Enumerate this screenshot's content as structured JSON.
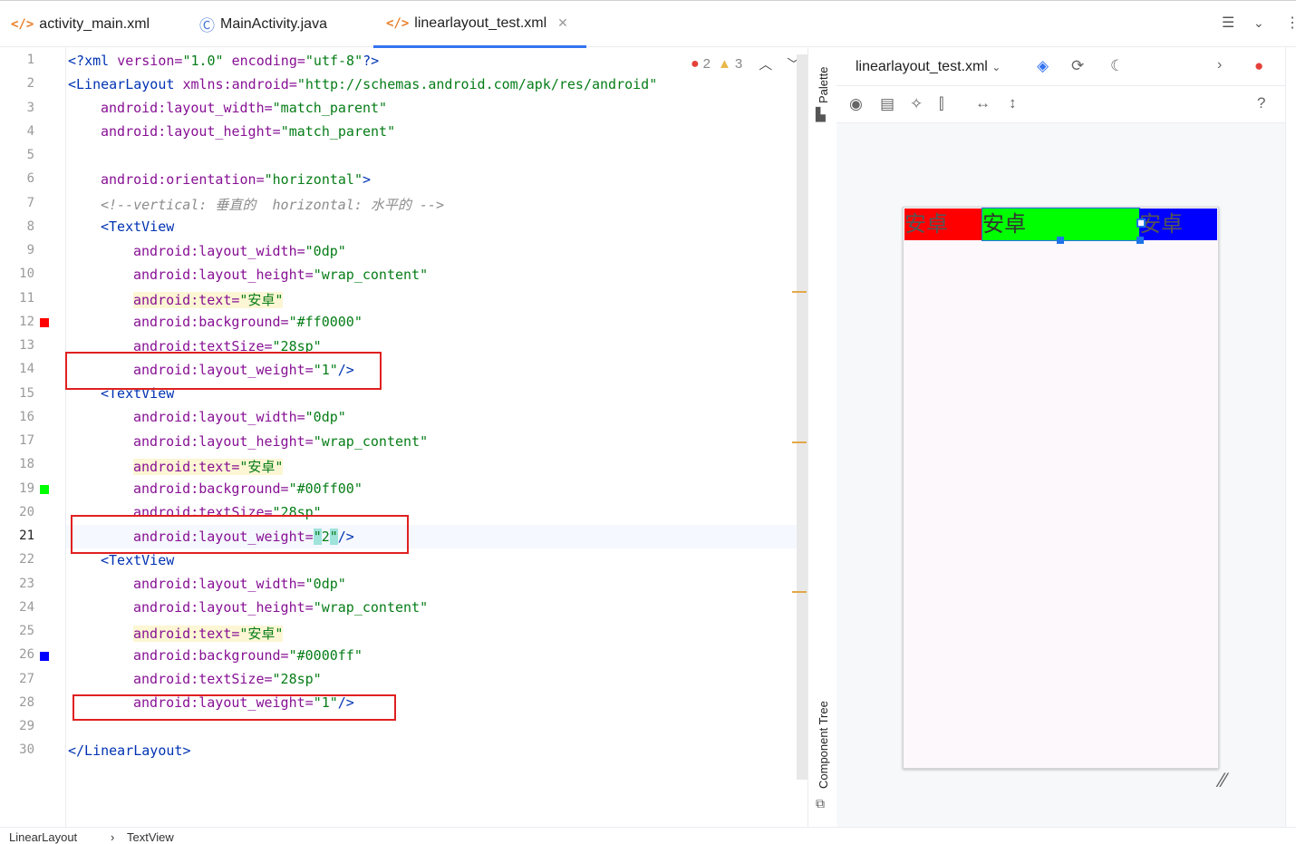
{
  "tabs": [
    {
      "label": "activity_main.xml",
      "icon": "xml-icon",
      "active": false
    },
    {
      "label": "MainActivity.java",
      "icon": "class-icon",
      "active": false
    },
    {
      "label": "linearlayout_test.xml",
      "icon": "xml-icon",
      "active": true
    }
  ],
  "problems": {
    "errors": "2",
    "warnings": "3"
  },
  "line_numbers": [
    "1",
    "2",
    "3",
    "4",
    "5",
    "6",
    "7",
    "8",
    "9",
    "10",
    "11",
    "12",
    "13",
    "14",
    "15",
    "16",
    "17",
    "18",
    "19",
    "20",
    "21",
    "22",
    "23",
    "24",
    "25",
    "26",
    "27",
    "28",
    "29",
    "30"
  ],
  "current_line": "21",
  "code": {
    "l1": {
      "a": "<?",
      "b": "xml ",
      "c": "version=",
      "d": "\"1.0\"",
      "e": " encoding=",
      "f": "\"utf-8\"",
      "g": "?>"
    },
    "l2": {
      "tag": "<LinearLayout ",
      "attr": "xmlns:android=",
      "val": "\"http://schemas.android.com/apk/res/android\""
    },
    "l3": {
      "attr": "android:layout_width=",
      "val": "\"match_parent\""
    },
    "l4": {
      "attr": "android:layout_height=",
      "val": "\"match_parent\""
    },
    "l6": {
      "attr": "android:orientation=",
      "val": "\"horizontal\"",
      "end": ">"
    },
    "l7": {
      "cm": "<!--vertical: 垂直的  horizontal: 水平的 -->"
    },
    "l8": {
      "tag": "<TextView"
    },
    "l9": {
      "attr": "android:layout_width=",
      "val": "\"0dp\""
    },
    "l10": {
      "attr": "android:layout_height=",
      "val": "\"wrap_content\""
    },
    "l11": {
      "attr": "android:text=",
      "val": "\"安卓\""
    },
    "l12": {
      "attr": "android:background=",
      "val": "\"#ff0000\""
    },
    "l13": {
      "attr": "android:textSize=",
      "val": "\"28sp\""
    },
    "l14": {
      "attr": "android:layout_weight=",
      "val": "\"1\"",
      "end": "/>"
    },
    "l15": {
      "tag": "<TextView"
    },
    "l16": {
      "attr": "android:layout_width=",
      "val": "\"0dp\""
    },
    "l17": {
      "attr": "android:layout_height=",
      "val": "\"wrap_content\""
    },
    "l18": {
      "attr": "android:text=",
      "val": "\"安卓\""
    },
    "l19": {
      "attr": "android:background=",
      "val": "\"#00ff00\""
    },
    "l20": {
      "attr": "android:textSize=",
      "val": "\"28sp\""
    },
    "l21": {
      "attr": "android:layout_weight=",
      "q1": "\"",
      "v": "2",
      "q2": "\"",
      "end": "/>"
    },
    "l22": {
      "tag": "<TextView"
    },
    "l23": {
      "attr": "android:layout_width=",
      "val": "\"0dp\""
    },
    "l24": {
      "attr": "android:layout_height=",
      "val": "\"wrap_content\""
    },
    "l25": {
      "attr": "android:text=",
      "val": "\"安卓\""
    },
    "l26": {
      "attr": "android:background=",
      "val": "\"#0000ff\""
    },
    "l27": {
      "attr": "android:textSize=",
      "val": "\"28sp\""
    },
    "l28": {
      "attr": "android:layout_weight=",
      "val": "\"1\"",
      "end": "/>"
    },
    "l30": {
      "tag": "</LinearLayout",
      "end": ">"
    }
  },
  "gutter_swatches": {
    "red": "#ff0000",
    "green": "#00ff00",
    "blue": "#0000ff"
  },
  "side_panels": {
    "palette": "Palette",
    "component_tree": "Component Tree"
  },
  "design": {
    "file_label": "linearlayout_test.xml",
    "preview_text": [
      "安卓",
      "安卓",
      "安卓"
    ],
    "weights": [
      1,
      2,
      1
    ],
    "help": "?"
  },
  "breadcrumb": {
    "item1": "LinearLayout",
    "sep": "›",
    "item2": "TextView"
  },
  "colors": {
    "accent": "#3574f0",
    "error": "#e5403a",
    "warning": "#e8b84a",
    "redbox": "#e02020"
  }
}
